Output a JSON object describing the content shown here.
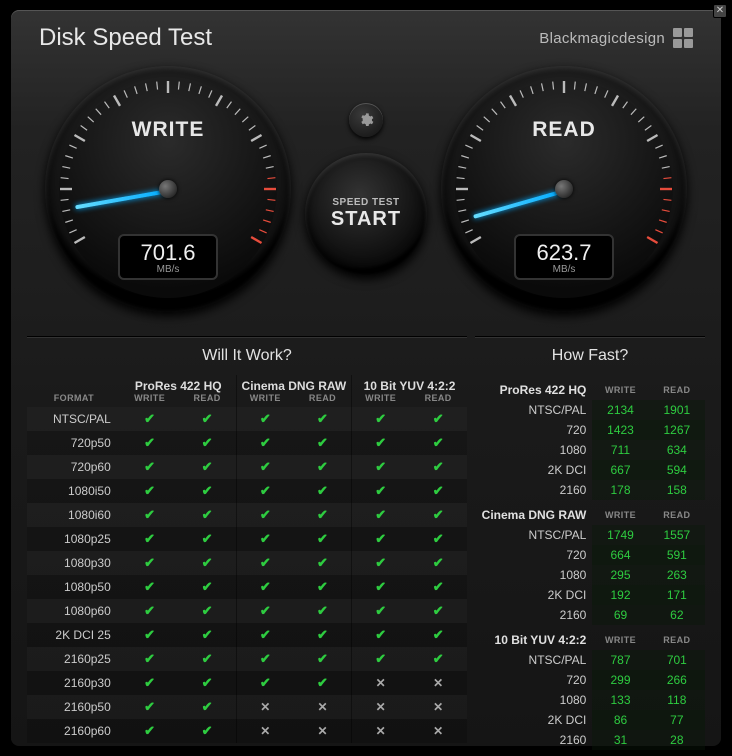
{
  "app": {
    "title": "Disk Speed Test",
    "brand": "Blackmagicdesign"
  },
  "controls": {
    "start_line1": "SPEED TEST",
    "start_line2": "START"
  },
  "gauges": {
    "write": {
      "label": "WRITE",
      "value": "701.6",
      "unit": "MB/s",
      "angle_deg": 170
    },
    "read": {
      "label": "READ",
      "value": "623.7",
      "unit": "MB/s",
      "angle_deg": 164
    }
  },
  "panels": {
    "left_title": "Will It Work?",
    "right_title": "How Fast?"
  },
  "wiw": {
    "side_label": "FORMAT",
    "sublabels": {
      "write": "WRITE",
      "read": "READ"
    },
    "groups": [
      "ProRes 422 HQ",
      "Cinema DNG RAW",
      "10 Bit YUV 4:2:2"
    ],
    "rows": [
      {
        "label": "NTSC/PAL",
        "cells": [
          1,
          1,
          1,
          1,
          1,
          1
        ]
      },
      {
        "label": "720p50",
        "cells": [
          1,
          1,
          1,
          1,
          1,
          1
        ]
      },
      {
        "label": "720p60",
        "cells": [
          1,
          1,
          1,
          1,
          1,
          1
        ]
      },
      {
        "label": "1080i50",
        "cells": [
          1,
          1,
          1,
          1,
          1,
          1
        ]
      },
      {
        "label": "1080i60",
        "cells": [
          1,
          1,
          1,
          1,
          1,
          1
        ]
      },
      {
        "label": "1080p25",
        "cells": [
          1,
          1,
          1,
          1,
          1,
          1
        ]
      },
      {
        "label": "1080p30",
        "cells": [
          1,
          1,
          1,
          1,
          1,
          1
        ]
      },
      {
        "label": "1080p50",
        "cells": [
          1,
          1,
          1,
          1,
          1,
          1
        ]
      },
      {
        "label": "1080p60",
        "cells": [
          1,
          1,
          1,
          1,
          1,
          1
        ]
      },
      {
        "label": "2K DCI 25",
        "cells": [
          1,
          1,
          1,
          1,
          1,
          1
        ]
      },
      {
        "label": "2160p25",
        "cells": [
          1,
          1,
          1,
          1,
          1,
          1
        ]
      },
      {
        "label": "2160p30",
        "cells": [
          1,
          1,
          1,
          1,
          0,
          0
        ]
      },
      {
        "label": "2160p50",
        "cells": [
          1,
          1,
          0,
          0,
          0,
          0
        ]
      },
      {
        "label": "2160p60",
        "cells": [
          1,
          1,
          0,
          0,
          0,
          0
        ]
      }
    ]
  },
  "hf": {
    "sublabels": {
      "write": "WRITE",
      "read": "READ"
    },
    "sections": [
      {
        "name": "ProRes 422 HQ",
        "rows": [
          {
            "label": "NTSC/PAL",
            "write": "2134",
            "read": "1901"
          },
          {
            "label": "720",
            "write": "1423",
            "read": "1267"
          },
          {
            "label": "1080",
            "write": "711",
            "read": "634"
          },
          {
            "label": "2K DCI",
            "write": "667",
            "read": "594"
          },
          {
            "label": "2160",
            "write": "178",
            "read": "158"
          }
        ]
      },
      {
        "name": "Cinema DNG RAW",
        "rows": [
          {
            "label": "NTSC/PAL",
            "write": "1749",
            "read": "1557"
          },
          {
            "label": "720",
            "write": "664",
            "read": "591"
          },
          {
            "label": "1080",
            "write": "295",
            "read": "263"
          },
          {
            "label": "2K DCI",
            "write": "192",
            "read": "171"
          },
          {
            "label": "2160",
            "write": "69",
            "read": "62"
          }
        ]
      },
      {
        "name": "10 Bit YUV 4:2:2",
        "rows": [
          {
            "label": "NTSC/PAL",
            "write": "787",
            "read": "701"
          },
          {
            "label": "720",
            "write": "299",
            "read": "266"
          },
          {
            "label": "1080",
            "write": "133",
            "read": "118"
          },
          {
            "label": "2K DCI",
            "write": "86",
            "read": "77"
          },
          {
            "label": "2160",
            "write": "31",
            "read": "28"
          }
        ]
      }
    ]
  }
}
